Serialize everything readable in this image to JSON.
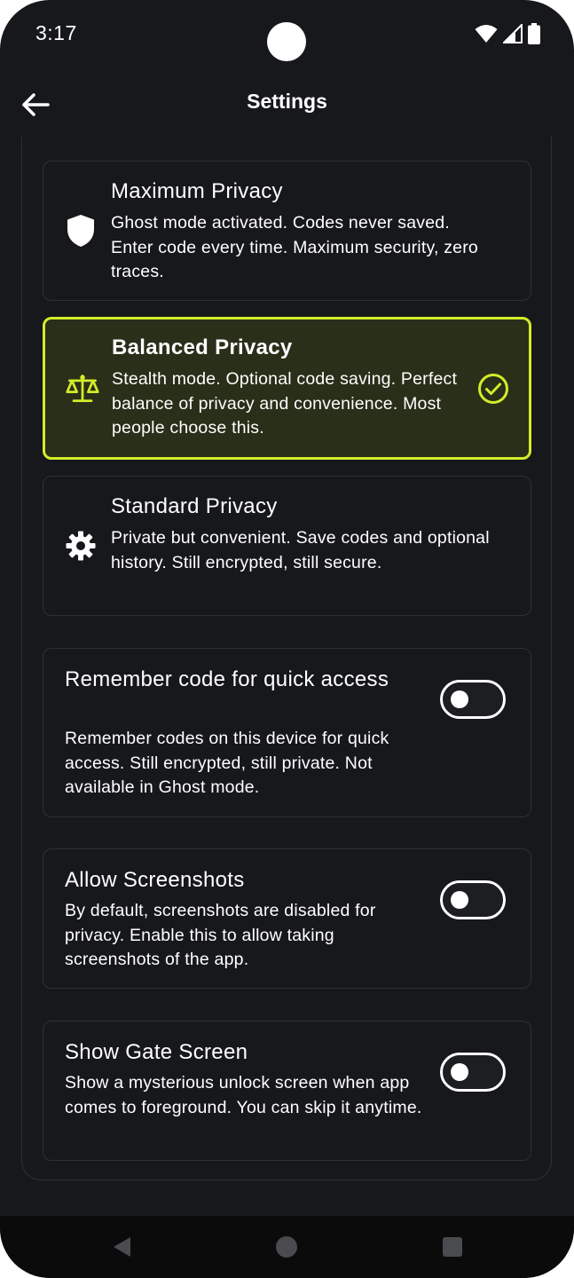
{
  "status_bar": {
    "time": "3:17"
  },
  "header": {
    "title": "Settings",
    "back_icon": "arrow-left-icon"
  },
  "privacy_modes": [
    {
      "title": "Maximum Privacy",
      "description": "Ghost mode activated. Codes never saved. Enter code every time. Maximum security, zero traces.",
      "icon": "shield-icon",
      "selected": false
    },
    {
      "title": "Balanced Privacy",
      "description": "Stealth mode. Optional code saving. Perfect balance of privacy and convenience. Most people choose this.",
      "icon": "balance-scale-icon",
      "selected": true
    },
    {
      "title": "Standard Privacy",
      "description": "Private but convenient. Save codes and optional history. Still encrypted, still secure.",
      "icon": "gear-icon",
      "selected": false
    }
  ],
  "toggles": [
    {
      "title": "Remember code for quick access",
      "description": "Remember codes on this device for quick access. Still encrypted, still private. Not available in Ghost mode.",
      "enabled": false
    },
    {
      "title": "Allow Screenshots",
      "description": "By default, screenshots are disabled for privacy. Enable this to allow taking screenshots of the app.",
      "enabled": false
    },
    {
      "title": "Show Gate Screen",
      "description": "Show a mysterious unlock screen when app comes to foreground. You can skip it anytime.",
      "enabled": false
    }
  ],
  "colors": {
    "background": "#17181b",
    "accent": "#d4ec2a",
    "selected_card_bg": "#2a2f19",
    "card_border": "#2e3035"
  }
}
